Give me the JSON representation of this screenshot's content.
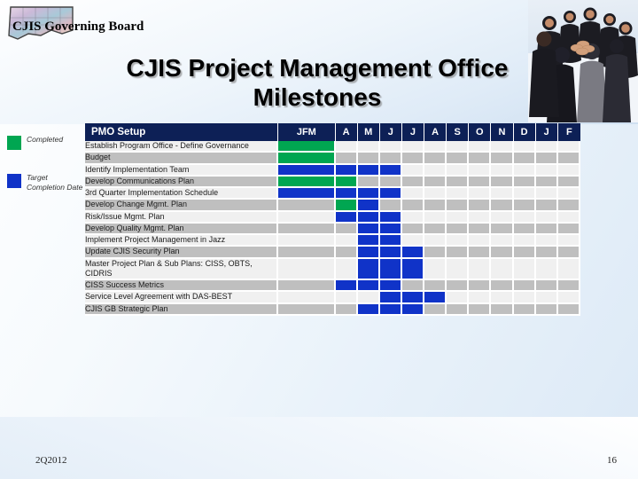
{
  "branding": {
    "org_name": "CJIS Governing Board",
    "logo_icon": "connecticut-map-icon",
    "photo_icon": "team-huddle-photo"
  },
  "slide": {
    "title_line1": "CJIS Project Management Office",
    "title_line2": "Milestones",
    "footer_date": "2Q2012",
    "page_number": "16"
  },
  "legend": {
    "items": [
      {
        "label": "Completed",
        "color": "#00a651"
      },
      {
        "label": "Target Completion Date",
        "color": "#1033c8"
      }
    ]
  },
  "colors": {
    "header_bg": "#0d2056",
    "completed": "#00a651",
    "target": "#1033c8",
    "row_light": "#f0f0f0",
    "row_dark": "#bfbfbf"
  },
  "chart_data": {
    "type": "table",
    "title": "PMO Setup",
    "task_column_header": "PMO Setup",
    "categories": [
      "JFM",
      "A",
      "M",
      "J",
      "J",
      "A",
      "S",
      "O",
      "N",
      "D",
      "J",
      "F"
    ],
    "legend": [
      "Completed",
      "Target Completion Date"
    ],
    "rows": [
      {
        "task": "Establish Program Office  - Define Governance",
        "cells": [
          "green",
          "",
          "",
          "",
          "",
          "",
          "",
          "",
          "",
          "",
          "",
          ""
        ]
      },
      {
        "task": "Budget",
        "cells": [
          "green",
          "",
          "",
          "",
          "",
          "",
          "",
          "",
          "",
          "",
          "",
          ""
        ]
      },
      {
        "task": "Identify Implementation Team",
        "cells": [
          "blue",
          "blue",
          "blue",
          "blue",
          "",
          "",
          "",
          "",
          "",
          "",
          "",
          ""
        ]
      },
      {
        "task": "Develop Communications Plan",
        "cells": [
          "green",
          "green",
          "",
          "",
          "",
          "",
          "",
          "",
          "",
          "",
          "",
          ""
        ]
      },
      {
        "task": "3rd Quarter Implementation Schedule",
        "cells": [
          "blue",
          "blue",
          "blue",
          "blue",
          "",
          "",
          "",
          "",
          "",
          "",
          "",
          ""
        ]
      },
      {
        "task": "Develop Change Mgmt. Plan",
        "cells": [
          "",
          "green",
          "blue",
          "",
          "",
          "",
          "",
          "",
          "",
          "",
          "",
          ""
        ]
      },
      {
        "task": "Risk/Issue Mgmt. Plan",
        "cells": [
          "",
          "blue",
          "blue",
          "blue",
          "",
          "",
          "",
          "",
          "",
          "",
          "",
          ""
        ]
      },
      {
        "task": "Develop Quality Mgmt. Plan",
        "cells": [
          "",
          "",
          "blue",
          "blue",
          "",
          "",
          "",
          "",
          "",
          "",
          "",
          ""
        ]
      },
      {
        "task": "Implement Project Management in Jazz",
        "cells": [
          "",
          "",
          "blue",
          "blue",
          "",
          "",
          "",
          "",
          "",
          "",
          "",
          ""
        ]
      },
      {
        "task": "Update CJIS Security Plan",
        "cells": [
          "",
          "",
          "blue",
          "blue",
          "blue",
          "",
          "",
          "",
          "",
          "",
          "",
          ""
        ]
      },
      {
        "task": "Master Project Plan & Sub Plans: CISS, OBTS, CIDRIS",
        "cells": [
          "",
          "",
          "blue",
          "blue",
          "blue",
          "",
          "",
          "",
          "",
          "",
          "",
          ""
        ]
      },
      {
        "task": "CISS Success Metrics",
        "cells": [
          "",
          "blue",
          "blue",
          "blue",
          "",
          "",
          "",
          "",
          "",
          "",
          "",
          ""
        ]
      },
      {
        "task": "Service Level Agreement with DAS-BEST",
        "cells": [
          "",
          "",
          "",
          "blue",
          "blue",
          "blue",
          "",
          "",
          "",
          "",
          "",
          ""
        ]
      },
      {
        "task": "CJIS GB Strategic Plan",
        "cells": [
          "",
          "",
          "blue",
          "blue",
          "blue",
          "",
          "",
          "",
          "",
          "",
          "",
          ""
        ]
      }
    ]
  }
}
